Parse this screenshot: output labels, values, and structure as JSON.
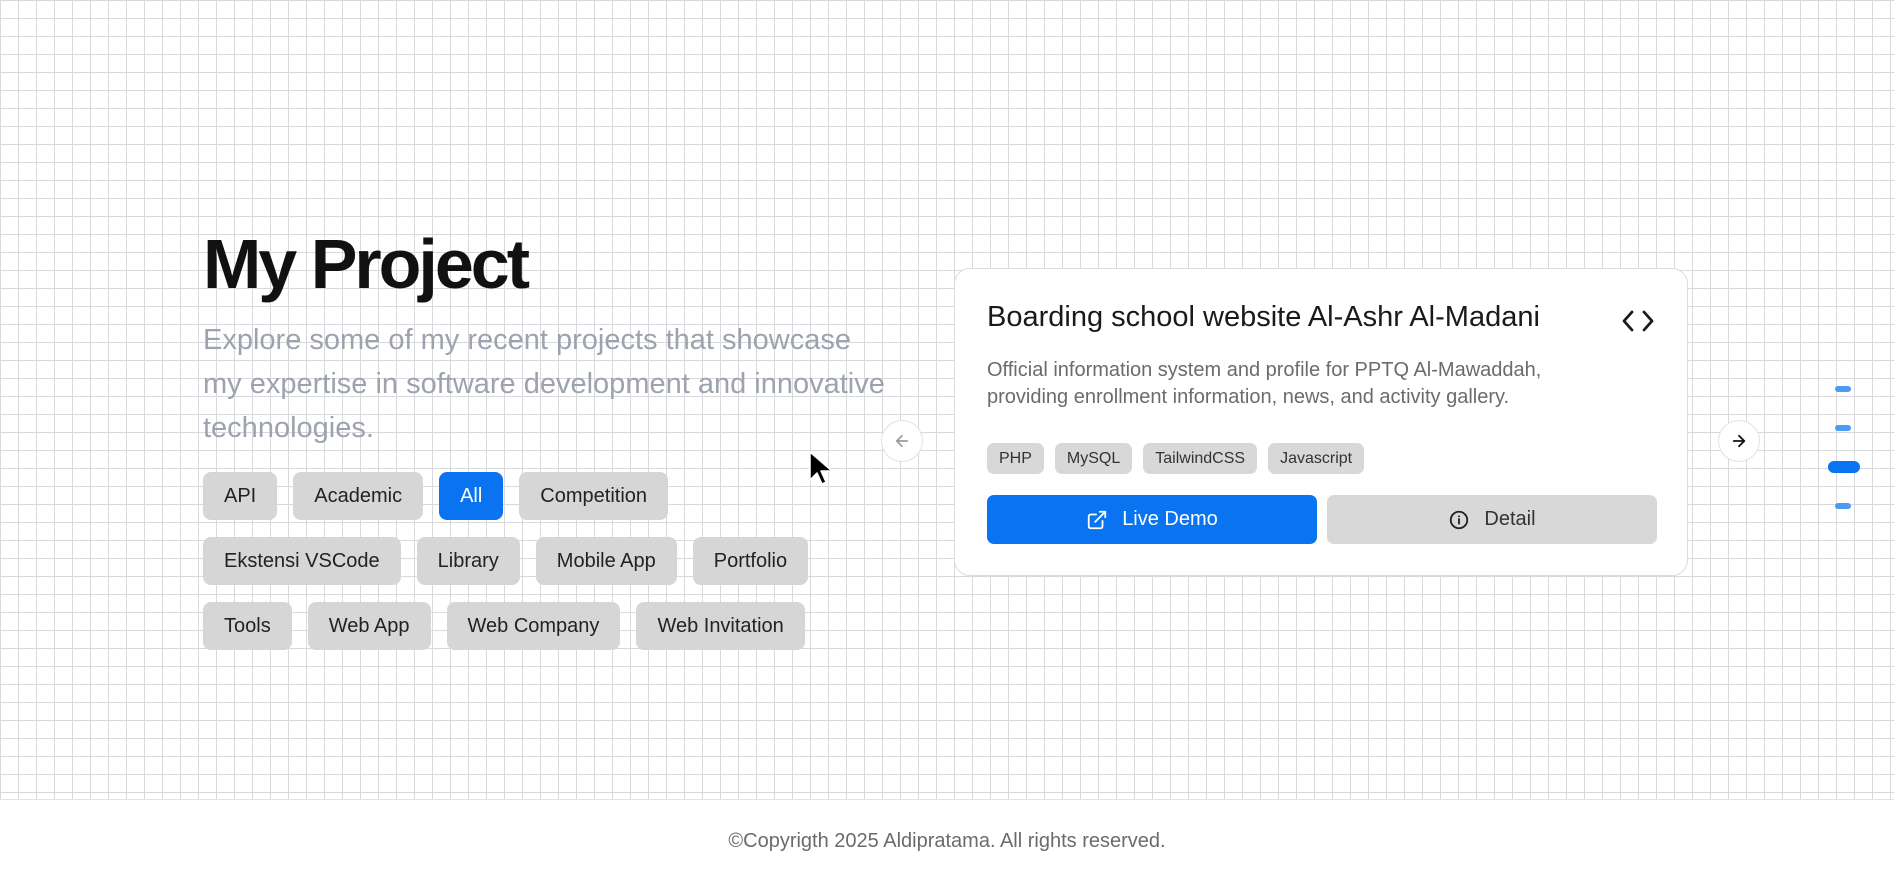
{
  "header": {
    "title": "My Project",
    "subtitle": "Explore some of my recent projects that showcase my expertise in software development and innovative technologies."
  },
  "filters": {
    "active": "All",
    "rows": [
      [
        "API",
        "Academic",
        "All",
        "Competition"
      ],
      [
        "Ekstensi VSCode",
        "Library",
        "Mobile App",
        "Portfolio"
      ],
      [
        "Tools",
        "Web App",
        "Web Company",
        "Web Invitation"
      ]
    ]
  },
  "carousel": {
    "prev_icon": "arrow-left-icon",
    "next_icon": "arrow-right-icon",
    "total_slides": 4,
    "active_slide": 3
  },
  "project": {
    "title": "Boarding school website Al-Ashr Al-Madani",
    "icon": "code-icon",
    "description": "Official information system and profile for PPTQ Al-Mawaddah, providing enrollment information, news, and activity gallery.",
    "tags": [
      "PHP",
      "MySQL",
      "TailwindCSS",
      "Javascript"
    ],
    "demo_label": "Live Demo",
    "demo_icon": "external-link-icon",
    "detail_label": "Detail",
    "detail_icon": "info-icon"
  },
  "colors": {
    "accent": "#0a73f0",
    "chip": "#d6d6d6",
    "subtitle": "#9ca3af"
  },
  "footer": {
    "text": "©Copyrigth 2025 Aldipratama. All rights reserved."
  }
}
